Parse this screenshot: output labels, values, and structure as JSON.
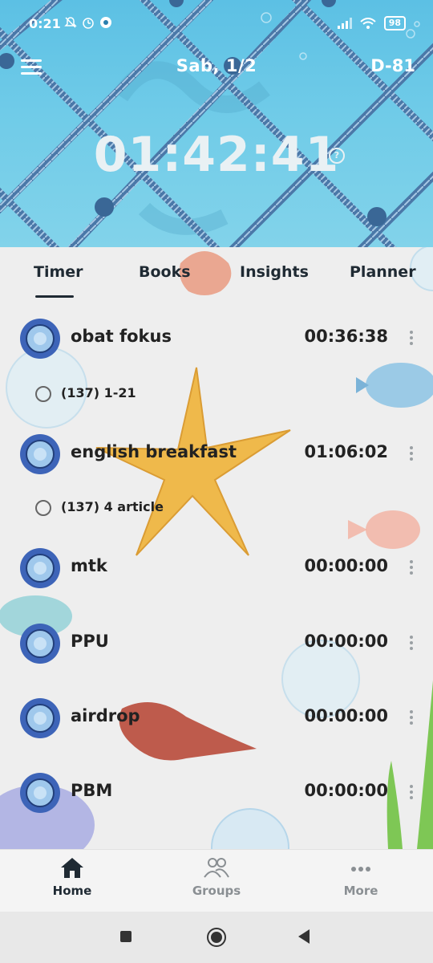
{
  "status_bar": {
    "time": "0:21",
    "battery": "98",
    "icons_left": [
      "bell-muted-icon",
      "alarm-icon",
      "settings-icon"
    ],
    "icons_right": [
      "signal-icon",
      "wifi-icon",
      "battery-icon"
    ]
  },
  "header": {
    "date": "Sab, 1/2",
    "dday": "D-81",
    "timer": "01:42:41"
  },
  "tabs": [
    {
      "label": "Timer",
      "active": true
    },
    {
      "label": "Books",
      "active": false
    },
    {
      "label": "Insights",
      "active": false
    },
    {
      "label": "Planner",
      "active": false
    }
  ],
  "subjects": [
    {
      "name": "obat fokus",
      "time": "00:36:38"
    },
    {
      "name": "english breakfast",
      "time": "01:06:02"
    },
    {
      "name": "mtk",
      "time": "00:00:00"
    },
    {
      "name": "PPU",
      "time": "00:00:00"
    },
    {
      "name": "airdrop",
      "time": "00:00:00"
    },
    {
      "name": "PBM",
      "time": "00:00:00"
    }
  ],
  "tasks": [
    {
      "label": "(137) 1-21"
    },
    {
      "label": "(137) 4 article"
    }
  ],
  "bottom_nav": [
    {
      "label": "Home",
      "icon": "home-icon",
      "active": true
    },
    {
      "label": "Groups",
      "icon": "groups-icon",
      "active": false
    },
    {
      "label": "More",
      "icon": "more-icon",
      "active": false
    }
  ],
  "colors": {
    "sky": "#5cc0e4",
    "paper": "#eeeeee",
    "text": "#1f2a33",
    "porthole_blue": "#3d64b8"
  }
}
